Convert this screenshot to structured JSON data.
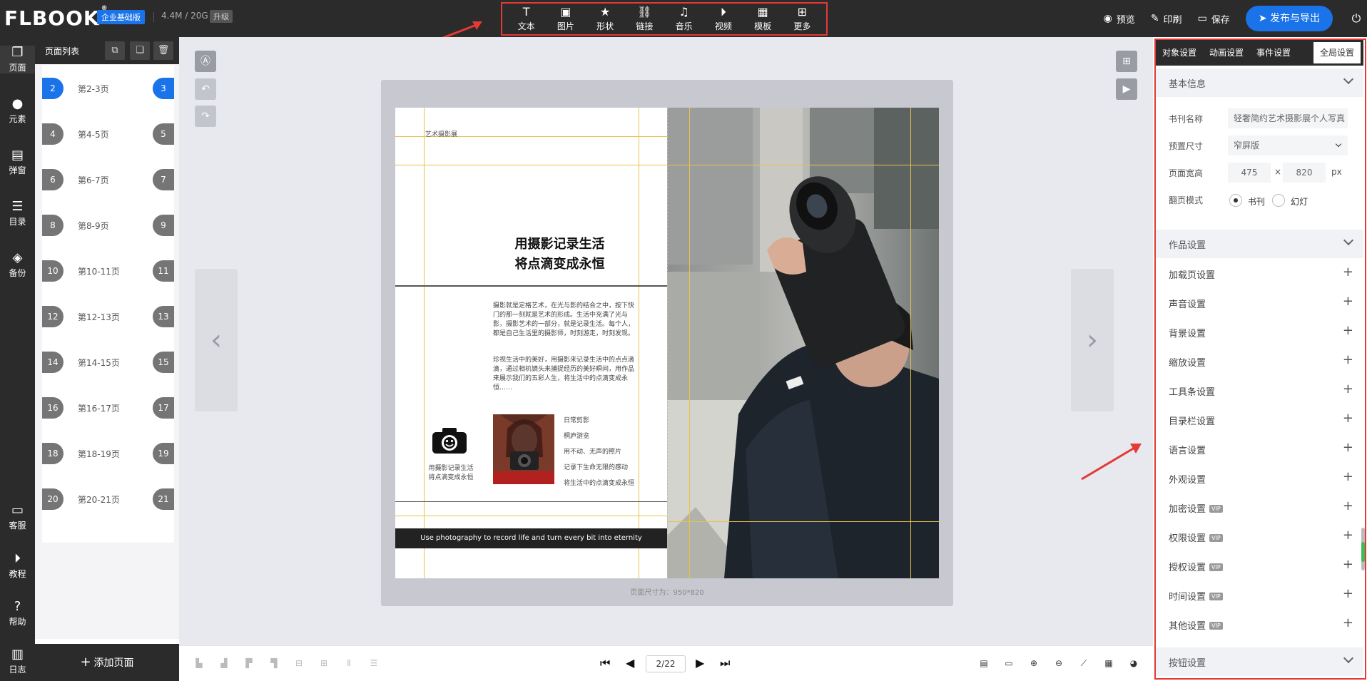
{
  "header": {
    "logo": "FLBOOK",
    "logo_mark": "®",
    "edition_badge": "企业基础版",
    "storage": "4.4M / 20G",
    "upgrade": "升级",
    "tools": [
      {
        "label": "文本",
        "icon": "text-icon"
      },
      {
        "label": "图片",
        "icon": "image-icon"
      },
      {
        "label": "形状",
        "icon": "star-icon"
      },
      {
        "label": "链接",
        "icon": "link-icon"
      },
      {
        "label": "音乐",
        "icon": "music-icon"
      },
      {
        "label": "视频",
        "icon": "video-icon"
      },
      {
        "label": "模板",
        "icon": "template-icon"
      },
      {
        "label": "更多",
        "icon": "more-icon"
      }
    ],
    "preview": "预览",
    "print": "印刷",
    "save": "保存",
    "publish": "发布与导出"
  },
  "iconbar": [
    {
      "label": "页面",
      "icon": "page-icon"
    },
    {
      "label": "元素",
      "icon": "elements-icon"
    },
    {
      "label": "弹窗",
      "icon": "popup-icon"
    },
    {
      "label": "目录",
      "icon": "toc-icon"
    },
    {
      "label": "备份",
      "icon": "layers-icon"
    },
    {
      "label": "客服",
      "icon": "chat-icon"
    },
    {
      "label": "教程",
      "icon": "play-icon"
    },
    {
      "label": "帮助",
      "icon": "help-icon"
    },
    {
      "label": "日志",
      "icon": "log-icon"
    }
  ],
  "page_list": {
    "title": "页面列表",
    "add_page": "添加页面",
    "items": [
      {
        "left": "2",
        "right": "3",
        "label": "第2-3页",
        "selected": true
      },
      {
        "left": "4",
        "right": "5",
        "label": "第4-5页"
      },
      {
        "left": "6",
        "right": "7",
        "label": "第6-7页"
      },
      {
        "left": "8",
        "right": "9",
        "label": "第8-9页"
      },
      {
        "left": "10",
        "right": "11",
        "label": "第10-11页"
      },
      {
        "left": "12",
        "right": "13",
        "label": "第12-13页"
      },
      {
        "left": "14",
        "right": "15",
        "label": "第14-15页"
      },
      {
        "left": "16",
        "right": "17",
        "label": "第16-17页"
      },
      {
        "left": "18",
        "right": "19",
        "label": "第18-19页"
      },
      {
        "left": "20",
        "right": "21",
        "label": "第20-21页"
      }
    ]
  },
  "canvas": {
    "page_size_text": "页面尺寸为：950*820",
    "exhibit_label": "艺术摄影展",
    "headline_1": "用摄影记录生活",
    "headline_2": "将点滴变成永恒",
    "paragraph_1": "摄影就是定格艺术，在光与影的结合之中，按下快门的那一刻就是艺术的形成。生活中充满了光与影，摄影艺术的一部分，就是记录生活。每个人，都是自己生活里的摄影师，时刻游走，时刻发现。",
    "paragraph_2": "珍视生活中的美好，用摄影来记录生活中的点点滴滴，通过相机镜头来捕捉经历的美好瞬间，用作品来展示我们的五彩人生，将生活中的点滴变成永恒……",
    "camera_caption_1": "用摄影记录生活",
    "camera_caption_2": "将点滴变成永恒",
    "list": [
      "日常剪影",
      "桐庐游览",
      "用不动、无声的照片",
      "记录下生命无限的感动",
      "将生活中的点滴变成永恒"
    ],
    "footer": "Use photography to record life and turn every bit into eternity"
  },
  "panel": {
    "tabs": [
      "对象设置",
      "动画设置",
      "事件设置",
      "全局设置"
    ],
    "basic_info": "基本信息",
    "book_name_label": "书刊名称",
    "book_name_value": "轻奢简约艺术摄影展个人写真",
    "preset_size_label": "预置尺寸",
    "preset_size_value": "窄屏版",
    "page_wh_label": "页面宽高",
    "width": "475",
    "times": "×",
    "height": "820",
    "unit": "px",
    "flip_mode_label": "翻页模式",
    "flip_book": "书刊",
    "flip_slide": "幻灯",
    "work_settings": "作品设置",
    "settings": [
      {
        "label": "加载页设置",
        "vip": false
      },
      {
        "label": "声音设置",
        "vip": false
      },
      {
        "label": "背景设置",
        "vip": false
      },
      {
        "label": "缩放设置",
        "vip": false
      },
      {
        "label": "工具条设置",
        "vip": false
      },
      {
        "label": "目录栏设置",
        "vip": false
      },
      {
        "label": "语言设置",
        "vip": false
      },
      {
        "label": "外观设置",
        "vip": false
      },
      {
        "label": "加密设置",
        "vip": true
      },
      {
        "label": "权限设置",
        "vip": true
      },
      {
        "label": "授权设置",
        "vip": true
      },
      {
        "label": "时间设置",
        "vip": true
      },
      {
        "label": "其他设置",
        "vip": true
      }
    ],
    "vip_text": "VIP",
    "button_settings": "按钮设置"
  },
  "pager": {
    "current": "2/22"
  },
  "colors": {
    "accent": "#1a73e8",
    "highlight": "#e53935",
    "dark": "#2b2b2b"
  }
}
